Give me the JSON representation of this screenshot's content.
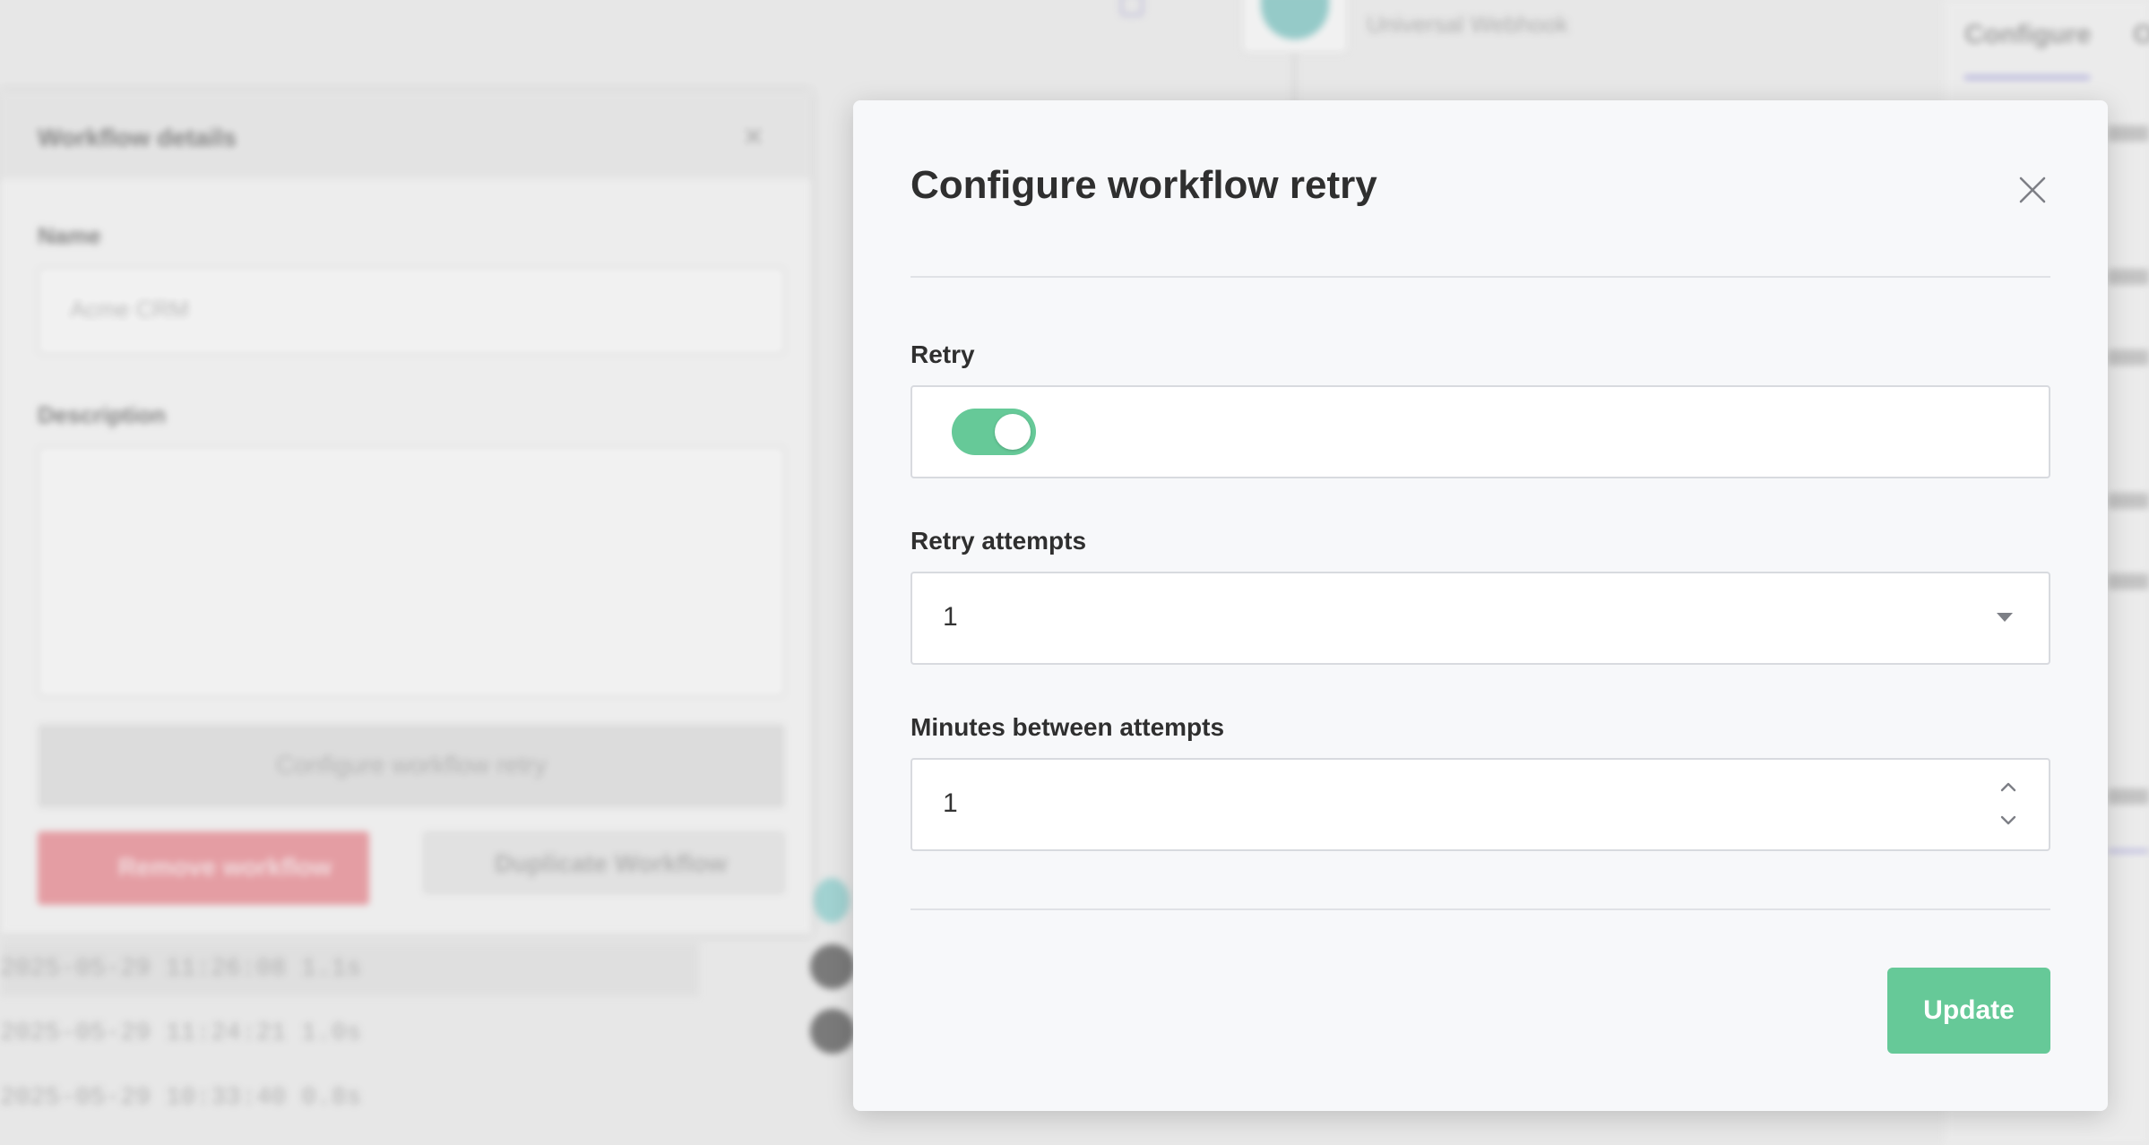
{
  "background": {
    "top_node_label": "Universal Webhook",
    "tabs": [
      "Configure",
      "O"
    ],
    "panel": {
      "title": "Workflow details",
      "name_label": "Name",
      "name_value": "Acme CRM",
      "description_label": "Description",
      "configure_retry_label": "Configure workflow retry",
      "remove_label": "Remove workflow",
      "duplicate_label": "Duplicate Workflow"
    },
    "runs": [
      {
        "timestamp": "2025-05-29 11:26:08",
        "duration": "1.1s"
      },
      {
        "timestamp": "2025-05-29 11:24:21",
        "duration": "1.0s"
      },
      {
        "timestamp": "2025-05-29 10:33:40",
        "duration": "0.8s"
      }
    ]
  },
  "modal": {
    "title": "Configure workflow retry",
    "retry": {
      "label": "Retry",
      "enabled": true
    },
    "retry_attempts": {
      "label": "Retry attempts",
      "value": "1"
    },
    "minutes_between": {
      "label": "Minutes between attempts",
      "value": "1"
    },
    "update_label": "Update"
  },
  "colors": {
    "accent_green": "#66c998",
    "danger_red": "#e98a92",
    "tab_underline": "#a9a6de"
  }
}
